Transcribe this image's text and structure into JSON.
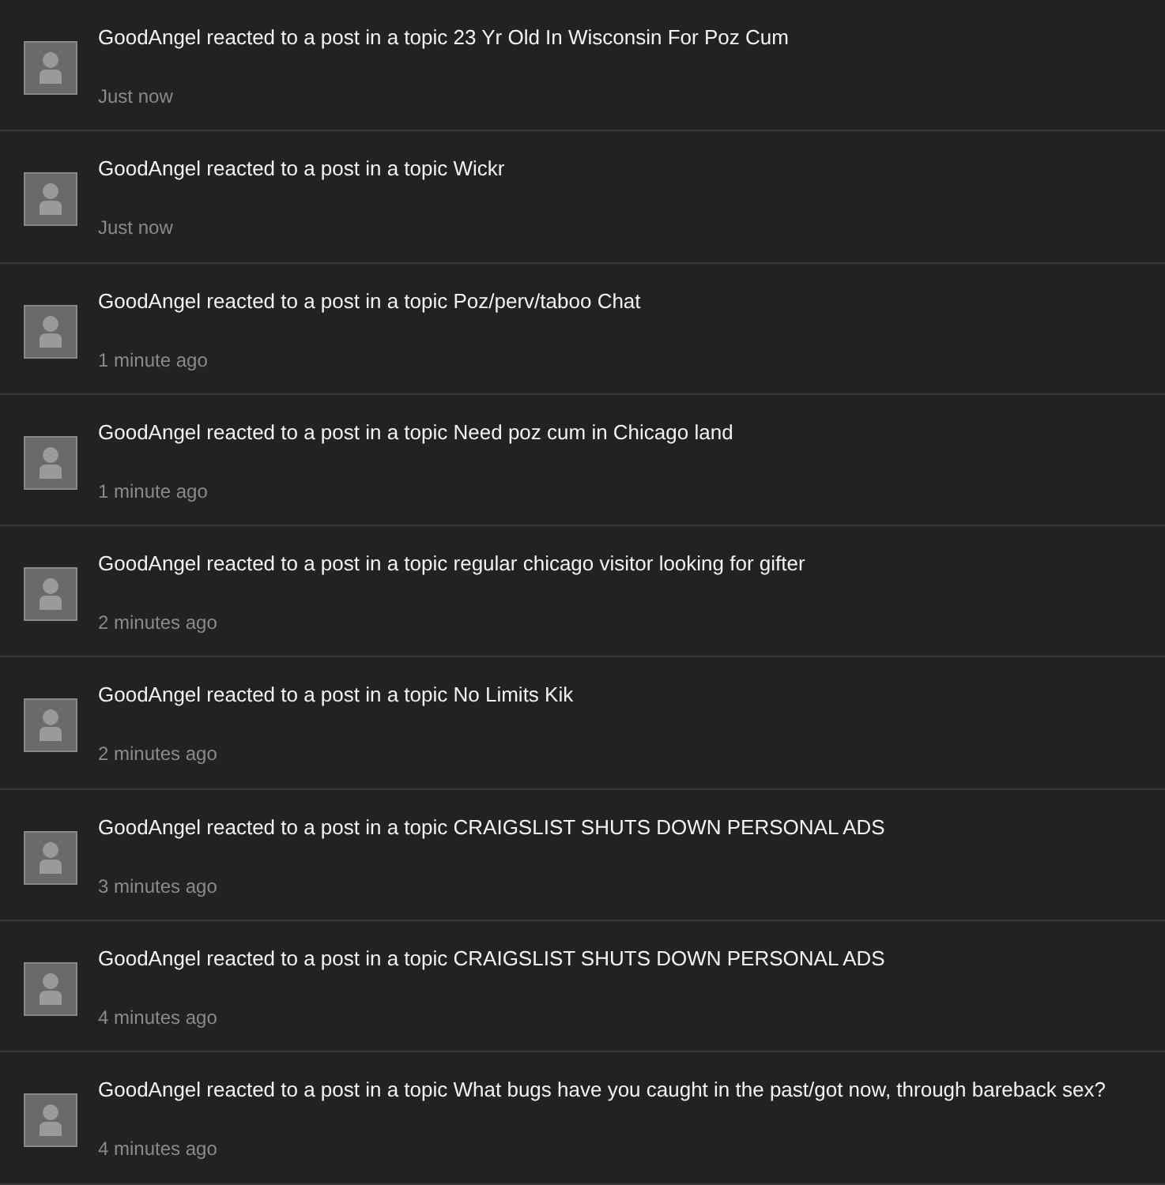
{
  "activity": [
    {
      "text": "GoodAngel reacted to a post in a topic 23 Yr Old In Wisconsin For Poz Cum",
      "time": "Just now"
    },
    {
      "text": "GoodAngel reacted to a post in a topic Wickr",
      "time": "Just now"
    },
    {
      "text": "GoodAngel reacted to a post in a topic Poz/perv/taboo Chat",
      "time": "1 minute ago"
    },
    {
      "text": "GoodAngel reacted to a post in a topic Need poz cum in Chicago land",
      "time": "1 minute ago"
    },
    {
      "text": "GoodAngel reacted to a post in a topic regular chicago visitor looking for gifter",
      "time": "2 minutes ago"
    },
    {
      "text": "GoodAngel reacted to a post in a topic No Limits Kik",
      "time": "2 minutes ago"
    },
    {
      "text": "GoodAngel reacted to a post in a topic CRAIGSLIST SHUTS DOWN PERSONAL ADS",
      "time": "3 minutes ago"
    },
    {
      "text": "GoodAngel reacted to a post in a topic CRAIGSLIST SHUTS DOWN PERSONAL ADS",
      "time": "4 minutes ago"
    },
    {
      "text": "GoodAngel reacted to a post in a topic What bugs have you caught in the past/got now, through bareback sex?",
      "time": "4 minutes ago"
    }
  ]
}
